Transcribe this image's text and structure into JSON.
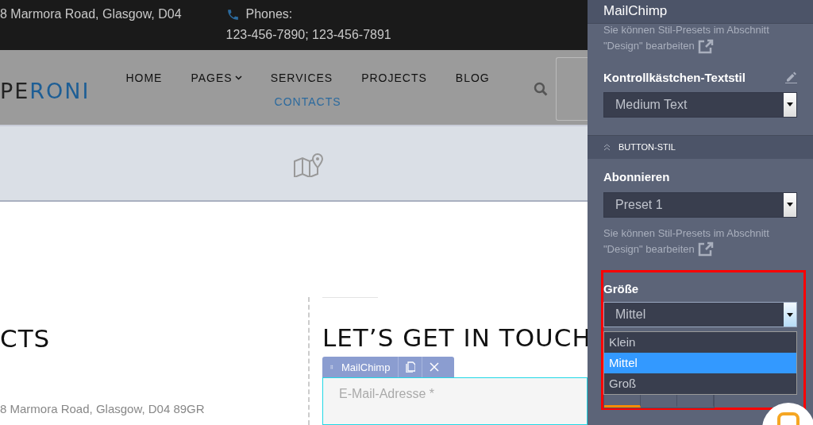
{
  "top_bar": {
    "address": "8 Marmora Road, Glasgow, D04",
    "phones_label": "Phones:",
    "phones": "123-456-7890; 123-456-7891"
  },
  "logo": {
    "dark": "PE",
    "accent": "RONI"
  },
  "nav": [
    {
      "label": "HOME",
      "selected": false,
      "dropdown": false
    },
    {
      "label": "PAGES",
      "selected": false,
      "dropdown": true
    },
    {
      "label": "SERVICES",
      "selected": false,
      "dropdown": false
    },
    {
      "label": "PROJECTS",
      "selected": false,
      "dropdown": false
    },
    {
      "label": "BLOG",
      "selected": false,
      "dropdown": false
    },
    {
      "label": "CONTACTS",
      "selected": true,
      "dropdown": false
    }
  ],
  "contacts": {
    "heading": "CTS",
    "address": "8 Marmora Road, Glasgow, D04 89GR"
  },
  "touch": {
    "heading": "LET’S GET IN TOUCH",
    "widget_label": "MailChimp",
    "email_placeholder": "E-Mail-Adresse *"
  },
  "panel": {
    "title": "MailChimp",
    "hint_top": "Sie können Stil-Presets im Abschnitt \"Design\" bearbeiten",
    "checkbox_style": {
      "label": "Kontrollkästchen-Textstil",
      "value": "Medium Text"
    },
    "section": {
      "label": "BUTTON-STIL",
      "expanded": true
    },
    "subscribe": {
      "label": "Abonnieren",
      "value": "Preset 1",
      "hint": "Sie können Stil-Presets im Abschnitt \"Design\" bearbeiten"
    },
    "size": {
      "label": "Größe",
      "value": "Mittel",
      "open": true,
      "highlighted": true,
      "options": [
        {
          "label": "Klein",
          "selected": false
        },
        {
          "label": "Mittel",
          "selected": true
        },
        {
          "label": "Groß",
          "selected": false
        }
      ]
    },
    "segments": [
      {
        "selected": true
      },
      {
        "selected": false
      },
      {
        "selected": false
      }
    ]
  }
}
